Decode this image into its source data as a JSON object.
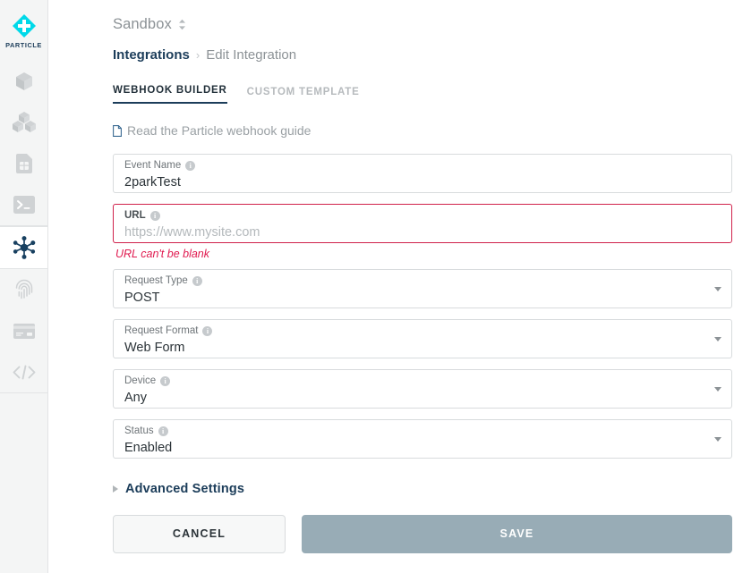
{
  "sidebar": {
    "logo": {
      "name": "particle-logo",
      "wordmark": "PARTICLE",
      "color": "#00d9e9"
    },
    "items": [
      {
        "name": "sidebar-item-device",
        "icon": "cube-icon",
        "active": false
      },
      {
        "name": "sidebar-item-fleet",
        "icon": "cubes-icon",
        "active": false
      },
      {
        "name": "sidebar-item-sim",
        "icon": "sim-card-icon",
        "active": false
      },
      {
        "name": "sidebar-item-console",
        "icon": "terminal-icon",
        "active": false
      },
      {
        "name": "sidebar-item-integrations",
        "icon": "integrations-node-icon",
        "active": true
      },
      {
        "name": "sidebar-item-authentication",
        "icon": "fingerprint-icon",
        "active": false
      },
      {
        "name": "sidebar-item-billing",
        "icon": "credit-card-icon",
        "active": false
      },
      {
        "name": "sidebar-item-developer",
        "icon": "code-brackets-icon",
        "active": false
      }
    ]
  },
  "org_switcher": {
    "label": "Sandbox",
    "icon": "chevron-up-down-icon"
  },
  "breadcrumb": {
    "parent": "Integrations",
    "separator": "›",
    "current": "Edit Integration"
  },
  "tabs": [
    {
      "label": "WEBHOOK BUILDER",
      "active": true
    },
    {
      "label": "CUSTOM TEMPLATE",
      "active": false
    }
  ],
  "guide_link": {
    "icon": "document-icon",
    "label": "Read the Particle webhook guide"
  },
  "form": {
    "fields": [
      {
        "name": "event-name",
        "label": "Event Name",
        "value": "2parkTest",
        "placeholder": "",
        "type": "text",
        "error": null,
        "info_icon": "info-icon"
      },
      {
        "name": "url",
        "label": "URL",
        "value": "",
        "placeholder": "https://www.mysite.com",
        "type": "text",
        "error": "URL can't be blank",
        "info_icon": "info-icon"
      },
      {
        "name": "request-type",
        "label": "Request Type",
        "value": "POST",
        "type": "select",
        "error": null,
        "info_icon": "info-icon"
      },
      {
        "name": "request-format",
        "label": "Request Format",
        "value": "Web Form",
        "type": "select",
        "error": null,
        "info_icon": "info-icon"
      },
      {
        "name": "device",
        "label": "Device",
        "value": "Any",
        "type": "select",
        "error": null,
        "info_icon": "info-icon"
      },
      {
        "name": "status",
        "label": "Status",
        "value": "Enabled",
        "type": "select",
        "error": null,
        "info_icon": "info-icon"
      }
    ],
    "advanced": {
      "label": "Advanced Settings",
      "icon": "triangle-right-icon",
      "expanded": false
    }
  },
  "actions": {
    "cancel_label": "CANCEL",
    "save_label": "SAVE",
    "save_color": "#98acb6",
    "save_enabled": false
  },
  "colors": {
    "brand_cyan": "#00d9e9",
    "navy": "#1c3d5a",
    "error_red": "#e01a4f",
    "error_border": "#d0214b",
    "sidebar_bg": "#f4f5f5",
    "icon_grey": "#c9cccf"
  }
}
